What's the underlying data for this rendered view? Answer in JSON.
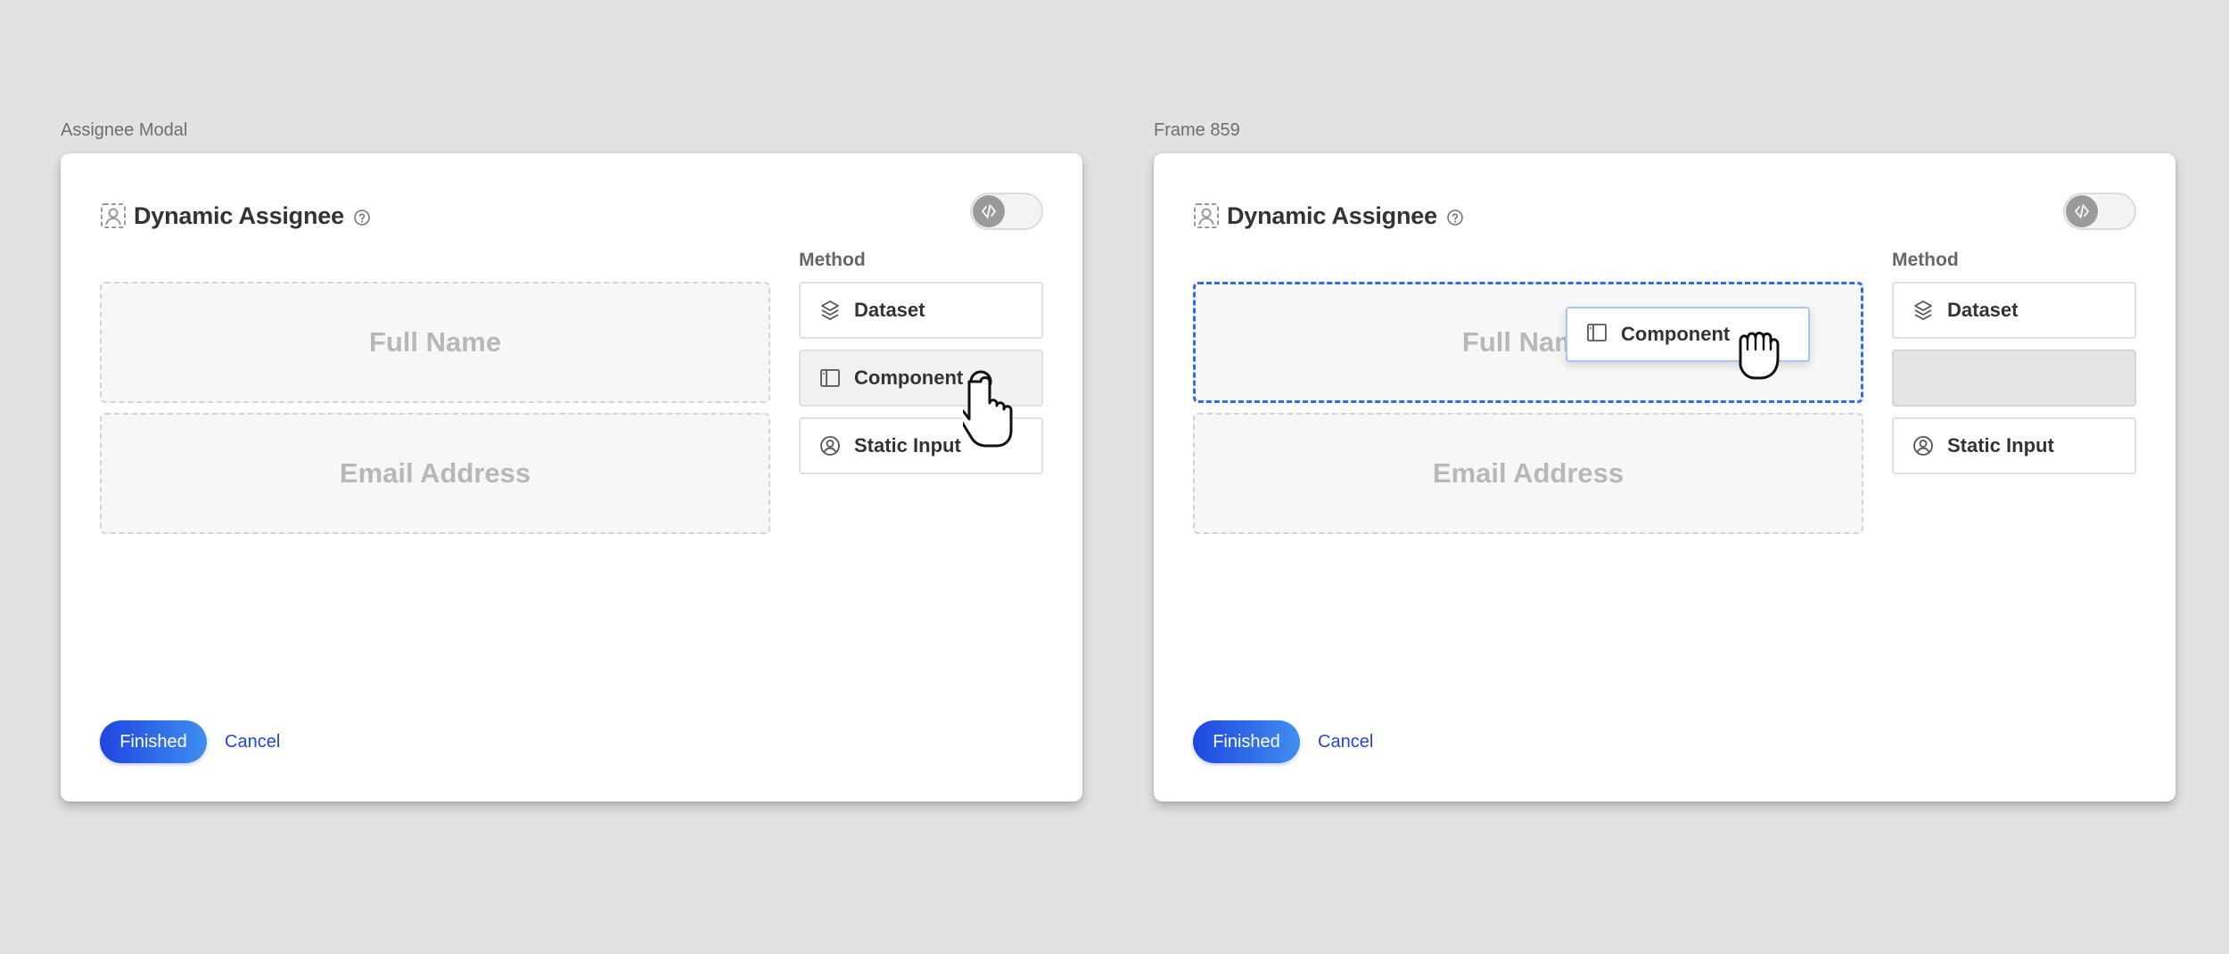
{
  "frames": [
    {
      "label": "Assignee Modal",
      "title": "Dynamic Assignee",
      "zones": [
        "Full Name",
        "Email Address"
      ],
      "method_label": "Method",
      "methods": [
        "Dataset",
        "Component",
        "Static Input"
      ],
      "finished_label": "Finished",
      "cancel_label": "Cancel"
    },
    {
      "label": "Frame 859",
      "title": "Dynamic Assignee",
      "zones": [
        "Full Name",
        "Email Address"
      ],
      "method_label": "Method",
      "methods": [
        "Dataset",
        "",
        "Static Input"
      ],
      "finished_label": "Finished",
      "cancel_label": "Cancel",
      "drag_chip_label": "Component"
    }
  ],
  "icons": {
    "title": "person-card-icon",
    "help": "question-circle-icon",
    "toggle": "code-icon",
    "dataset": "layers-icon",
    "component": "sidebar-panel-icon",
    "static_input": "user-circle-icon",
    "cursor_point": "pointing-hand-cursor",
    "cursor_grab": "grabbing-hand-cursor"
  },
  "colors": {
    "accent": "#1f46e0",
    "accent_light": "#3f8ef0",
    "drop_highlight": "#2f6bef",
    "background": "#e2e2e2"
  }
}
